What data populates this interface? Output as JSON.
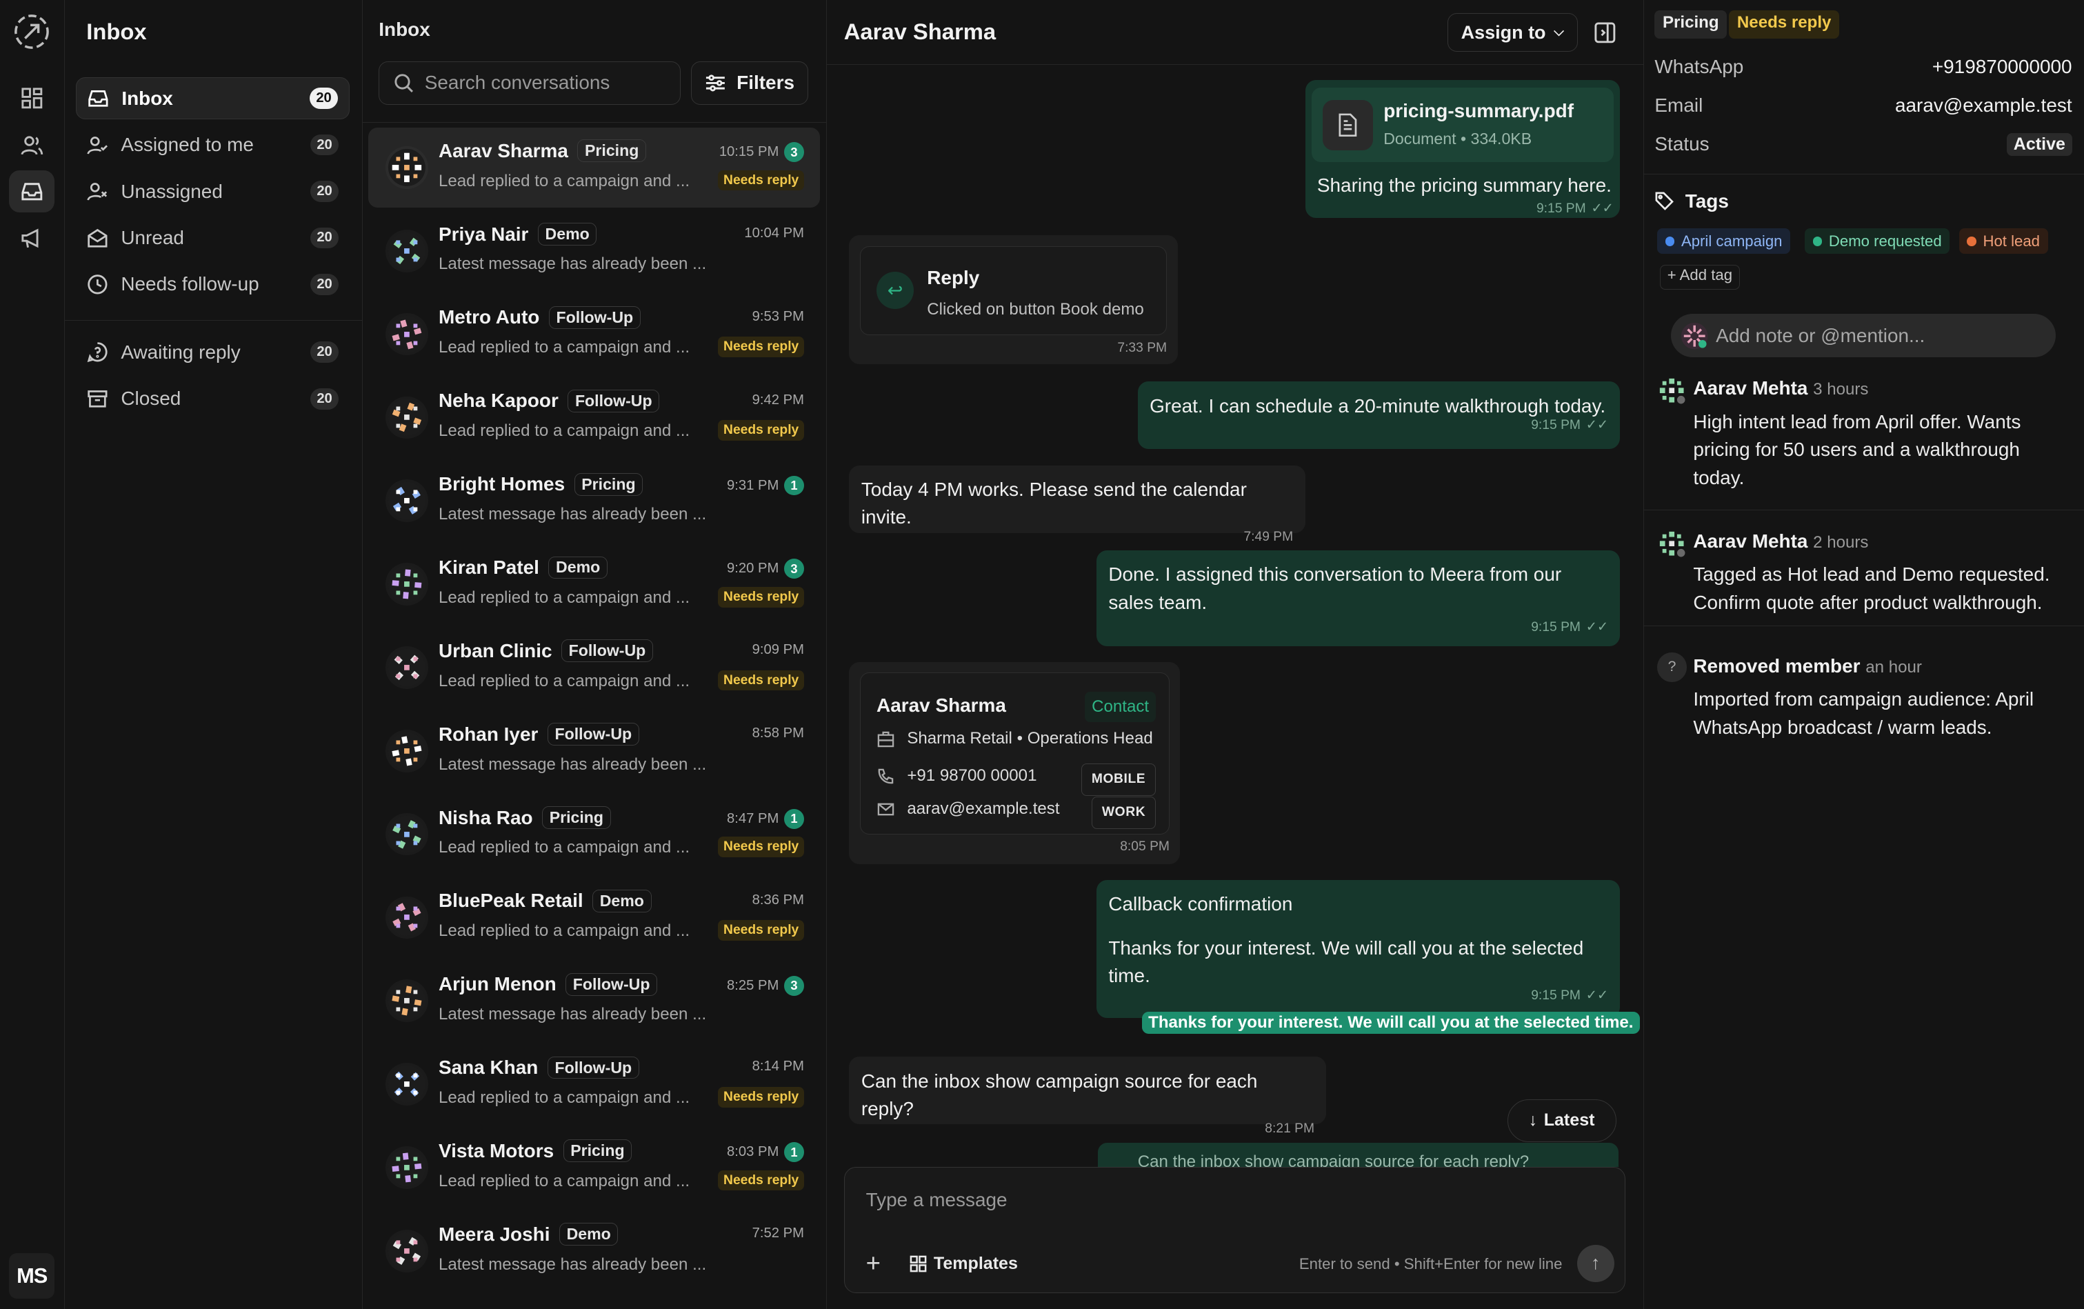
{
  "nav": {
    "title": "Inbox",
    "items": [
      {
        "label": "Inbox",
        "count": "20"
      },
      {
        "label": "Assigned to me",
        "count": "20"
      },
      {
        "label": "Unassigned",
        "count": "20"
      },
      {
        "label": "Unread",
        "count": "20"
      },
      {
        "label": "Needs follow-up",
        "count": "20"
      },
      {
        "label": "Awaiting reply",
        "count": "20"
      },
      {
        "label": "Closed",
        "count": "20"
      }
    ],
    "user_initials": "MS"
  },
  "list": {
    "title": "Inbox",
    "search_placeholder": "Search conversations",
    "filters_label": "Filters",
    "conversations": [
      {
        "name": "Aarav Sharma",
        "tag": "Pricing",
        "preview": "Lead replied to a campaign and ...",
        "time": "10:15 PM",
        "unread": "3",
        "badge": "Needs reply"
      },
      {
        "name": "Priya Nair",
        "tag": "Demo",
        "preview": "Latest message has already been ...",
        "time": "10:04 PM",
        "unread": "",
        "badge": ""
      },
      {
        "name": "Metro Auto",
        "tag": "Follow-Up",
        "preview": "Lead replied to a campaign and ...",
        "time": "9:53 PM",
        "unread": "",
        "badge": "Needs reply"
      },
      {
        "name": "Neha Kapoor",
        "tag": "Follow-Up",
        "preview": "Lead replied to a campaign and ...",
        "time": "9:42 PM",
        "unread": "",
        "badge": "Needs reply"
      },
      {
        "name": "Bright Homes",
        "tag": "Pricing",
        "preview": "Latest message has already been ...",
        "time": "9:31 PM",
        "unread": "1",
        "badge": ""
      },
      {
        "name": "Kiran Patel",
        "tag": "Demo",
        "preview": "Lead replied to a campaign and ...",
        "time": "9:20 PM",
        "unread": "3",
        "badge": "Needs reply"
      },
      {
        "name": "Urban Clinic",
        "tag": "Follow-Up",
        "preview": "Lead replied to a campaign and ...",
        "time": "9:09 PM",
        "unread": "",
        "badge": "Needs reply"
      },
      {
        "name": "Rohan Iyer",
        "tag": "Follow-Up",
        "preview": "Latest message has already been ...",
        "time": "8:58 PM",
        "unread": "",
        "badge": ""
      },
      {
        "name": "Nisha Rao",
        "tag": "Pricing",
        "preview": "Lead replied to a campaign and ...",
        "time": "8:47 PM",
        "unread": "1",
        "badge": "Needs reply"
      },
      {
        "name": "BluePeak Retail",
        "tag": "Demo",
        "preview": "Lead replied to a campaign and ...",
        "time": "8:36 PM",
        "unread": "",
        "badge": "Needs reply"
      },
      {
        "name": "Arjun Menon",
        "tag": "Follow-Up",
        "preview": "Latest message has already been ...",
        "time": "8:25 PM",
        "unread": "3",
        "badge": ""
      },
      {
        "name": "Sana Khan",
        "tag": "Follow-Up",
        "preview": "Lead replied to a campaign and ...",
        "time": "8:14 PM",
        "unread": "",
        "badge": "Needs reply"
      },
      {
        "name": "Vista Motors",
        "tag": "Pricing",
        "preview": "Lead replied to a campaign and ...",
        "time": "8:03 PM",
        "unread": "1",
        "badge": "Needs reply"
      },
      {
        "name": "Meera Joshi",
        "tag": "Demo",
        "preview": "Latest message has already been ...",
        "time": "7:52 PM",
        "unread": "",
        "badge": ""
      }
    ]
  },
  "chat": {
    "contact_name": "Aarav Sharma",
    "assign_label": "Assign to",
    "doc_name": "pricing-summary.pdf",
    "doc_meta": "Document • 334.0KB",
    "doc_caption": "Sharing the pricing summary here.",
    "doc_time": "9:15 PM",
    "reply_title": "Reply",
    "reply_sub": "Clicked on button Book demo",
    "reply_time": "7:33 PM",
    "m1_text": "Great. I can schedule a 20-minute walkthrough today.",
    "m1_time": "9:15 PM",
    "m2_text": "Today 4 PM works. Please send the calendar invite.",
    "m2_time": "7:49 PM",
    "m3_text": "Done. I assigned this conversation to Meera from our sales team.",
    "m3_time": "9:15 PM",
    "vcard_name": "Aarav Sharma",
    "vcard_badge": "Contact",
    "vcard_org": "Sharma Retail • Operations Head",
    "vcard_phone": "+91 98700 00001",
    "vcard_phone_type": "MOBILE",
    "vcard_email": "aarav@example.test",
    "vcard_email_type": "WORK",
    "vcard_time": "8:05 PM",
    "m4_title": "Callback confirmation",
    "m4_text": "Thanks for your interest. We will call you at the selected time.",
    "m4_time": "9:15 PM",
    "m4_button": "Thanks for your interest. We will call you at the selected time.",
    "m5_text": "Can the inbox show campaign source for each reply?",
    "m5_time": "8:21 PM",
    "latest_label": "Latest",
    "ghost_text": "Can the inbox show campaign source for each reply?",
    "composer_placeholder": "Type a message",
    "templates_label": "Templates",
    "composer_hint": "Enter to send • Shift+Enter for new line"
  },
  "side": {
    "pill_pricing": "Pricing",
    "pill_needs": "Needs reply",
    "whatsapp_label": "WhatsApp",
    "whatsapp_value": "+919870000000",
    "email_label": "Email",
    "email_value": "aarav@example.test",
    "status_label": "Status",
    "status_value": "Active",
    "tags_title": "Tags",
    "tags": [
      {
        "label": "April campaign",
        "color": "#4a8cf0"
      },
      {
        "label": "Demo requested",
        "color": "#2fb586"
      },
      {
        "label": "Hot lead",
        "color": "#e8703a"
      }
    ],
    "add_tag": "+ Add tag",
    "note_placeholder": "Add note or @mention...",
    "activity": [
      {
        "name": "Aarav Mehta",
        "ago": "3 hours",
        "body": "High intent lead from April offer. Wants pricing for 50 users and a walkthrough today."
      },
      {
        "name": "Aarav Mehta",
        "ago": "2 hours",
        "body": "Tagged as Hot lead and Demo requested. Confirm quote after product walkthrough."
      },
      {
        "name": "Removed member",
        "ago": "an hour",
        "body": "Imported from campaign audience: April WhatsApp broadcast / warm leads."
      }
    ]
  }
}
